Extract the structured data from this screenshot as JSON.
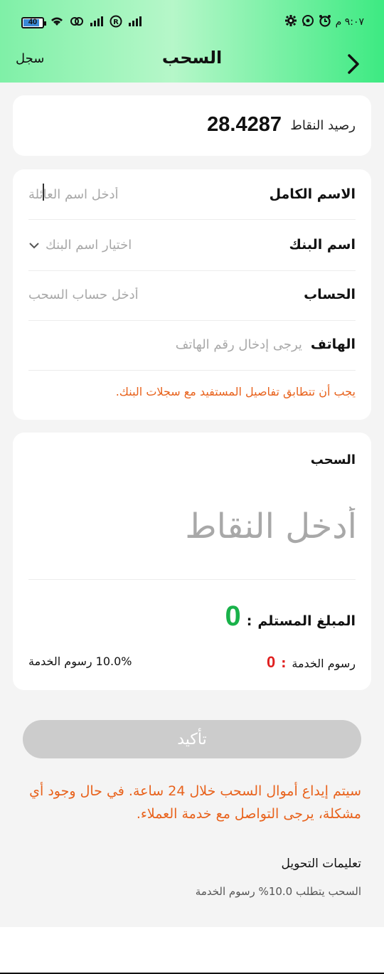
{
  "status_bar": {
    "battery": "40",
    "left_glyphs": [
      "wifi-icon",
      "link-icon",
      "signal-icon",
      "registered-icon",
      "signal-icon"
    ],
    "time": "٩:٠٧ م",
    "right_icons": [
      "settings-icon",
      "whatsapp-icon",
      "alarm-icon"
    ]
  },
  "nav": {
    "title": "السحب",
    "log_label": "سجل",
    "back_glyph": "›"
  },
  "balance": {
    "label": "رصيد النقاط",
    "value": "28.4287"
  },
  "form": {
    "name_label": "الاسم الكامل",
    "name_placeholder": "أدخل اسم العائلة",
    "bank_label": "اسم البنك",
    "bank_placeholder": "اختيار اسم البنك",
    "account_label": "الحساب",
    "account_placeholder": "أدخل حساب السحب",
    "phone_label": "الهاتف",
    "phone_placeholder": "يرجى إدخال رقم الهاتف",
    "warning": "يجب أن تتطابق تفاصيل المستفيد مع سجلات البنك."
  },
  "withdraw": {
    "title": "السحب",
    "amount_placeholder": "أدخل النقاط",
    "received_label": "المبلغ المستلم",
    "received_value": "0",
    "fee_label": "رسوم الخدمة",
    "fee_value": "0",
    "rate_text": "10.0% رسوم الخدمة",
    "colon": ":"
  },
  "confirm_label": "تأكيد",
  "notice": "سيتم إيداع أموال السحب خلال 24 ساعة. في حال وجود أي مشكلة، يرجى التواصل مع خدمة العملاء.",
  "instructions": {
    "title": "تعليمات التحويل",
    "body": "السحب يتطلب 10.0% رسوم الخدمة"
  },
  "colors": {
    "accent_green": "#19b24a",
    "warning_orange": "#e8621c",
    "fee_red": "#e02020",
    "header_gradient_start": "#7ff0a7",
    "header_gradient_end": "#3dea82"
  }
}
